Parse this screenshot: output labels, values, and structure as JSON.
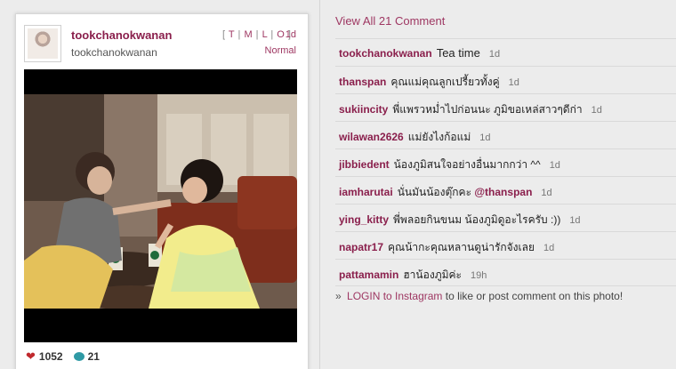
{
  "post": {
    "username": "tookchanokwanan",
    "fullname": "tookchanokwanan",
    "size_bracket_open": "[",
    "size_bracket_close": "]",
    "size_links": [
      "T",
      "M",
      "L",
      "O"
    ],
    "time_ago": "1d",
    "filter": "Normal",
    "likes": "1052",
    "comment_count": "21"
  },
  "comments_header": "View All 21 Comment",
  "comments": [
    {
      "user": "tookchanokwanan",
      "text": "Tea time",
      "mention": "",
      "after": "",
      "time": "1d"
    },
    {
      "user": "thanspan",
      "text": "คุณแม่คุณลูกเปรี้ยวทั้งคู่",
      "mention": "",
      "after": "",
      "time": "1d"
    },
    {
      "user": "sukiincity",
      "text": "พี่แพรวหม่ำไปก่อนนะ ภูมิขอเหล่สาวๆดีก่า",
      "mention": "",
      "after": "",
      "time": "1d"
    },
    {
      "user": "wilawan2626",
      "text": "แม่ยังไงก้อแม่",
      "mention": "",
      "after": "",
      "time": "1d"
    },
    {
      "user": "jibbiedent",
      "text": "น้องภูมิสนใจอย่างอื่นมากกว่า ^^",
      "mention": "",
      "after": "",
      "time": "1d"
    },
    {
      "user": "iamharutai",
      "text": "นั่นมันน้องตุ๊กคะ",
      "mention": "@thanspan",
      "after": "",
      "time": "1d"
    },
    {
      "user": "ying_kitty",
      "text": "พี่พลอยกินขนม น้องภูมิดูอะไรครับ :))",
      "mention": "",
      "after": "",
      "time": "1d"
    },
    {
      "user": "napatr17",
      "text": "คุณน้ากะคุณหลานดูน่ารักจังเลย",
      "mention": "",
      "after": "",
      "time": "1d"
    },
    {
      "user": "pattamamin",
      "text": "ฮาน้องภูมิค่ะ",
      "mention": "",
      "after": "",
      "time": "19h"
    }
  ],
  "login": {
    "prefix": "»",
    "link_text": "LOGIN to Instagram",
    "suffix": "to like or post comment on this photo!"
  },
  "colors": {
    "accent": "#9e3762",
    "username": "#8a1f4c",
    "heart": "#c0292d",
    "bubble": "#2f9aa5"
  },
  "icons": [
    "heart-icon",
    "comment-bubble-icon"
  ]
}
